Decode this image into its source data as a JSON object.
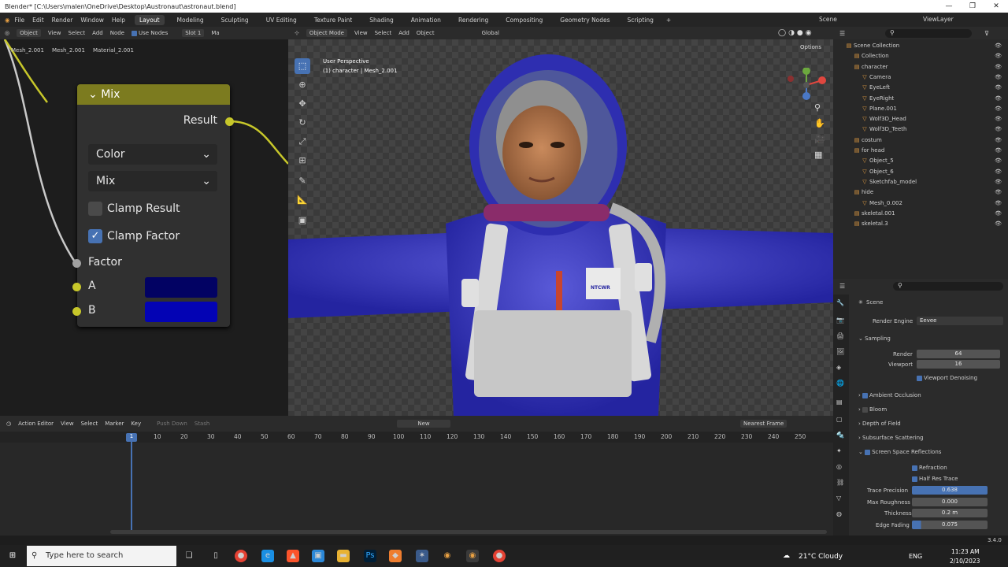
{
  "window": {
    "title": "Blender* [C:\\Users\\malen\\OneDrive\\Desktop\\Austronaut\\astronaut.blend]"
  },
  "menu": {
    "items": [
      "File",
      "Edit",
      "Render",
      "Window",
      "Help"
    ],
    "workspaces": [
      "Layout",
      "Modeling",
      "Sculpting",
      "UV Editing",
      "Texture Paint",
      "Shading",
      "Animation",
      "Rendering",
      "Compositing",
      "Geometry Nodes",
      "Scripting"
    ],
    "add": "+",
    "scene_label": "Scene",
    "viewlayer_label": "ViewLayer"
  },
  "node_editor": {
    "header": {
      "mode": "Object",
      "menus": [
        "View",
        "Select",
        "Add",
        "Node"
      ],
      "use_nodes": "Use Nodes",
      "slot": "Slot 1",
      "truncated": "Ma"
    },
    "breadcrumb": [
      "Mesh_2.001",
      "Mesh_2.001",
      "Material_2.001"
    ],
    "node": {
      "title": "Mix",
      "output": "Result",
      "data_type": "Color",
      "blend_mode": "Mix",
      "clamp_result": "Clamp Result",
      "clamp_factor": "Clamp Factor",
      "factor": "Factor",
      "input_a": "A",
      "input_b": "B",
      "color_a": "#020263",
      "color_b": "#0303b4",
      "clamp_result_checked": false,
      "clamp_factor_checked": true
    }
  },
  "viewport": {
    "header": {
      "mode": "Object Mode",
      "menus": [
        "View",
        "Select",
        "Add",
        "Object"
      ],
      "transform": "Global"
    },
    "overlay_line1": "User Perspective",
    "overlay_line2": "(1) character | Mesh_2.001",
    "options": "Options",
    "badge": "NTCWR"
  },
  "timeline": {
    "editor": "Action Editor",
    "menus": [
      "View",
      "Select",
      "Marker",
      "Key"
    ],
    "push_down": "Push Down",
    "stash": "Stash",
    "new": "New",
    "snap": "Nearest Frame",
    "current_frame": "1",
    "ticks": [
      "10",
      "20",
      "30",
      "40",
      "50",
      "60",
      "70",
      "80",
      "90",
      "100",
      "110",
      "120",
      "130",
      "140",
      "150",
      "160",
      "170",
      "180",
      "190",
      "200",
      "210",
      "220",
      "230",
      "240",
      "250"
    ]
  },
  "outliner": {
    "rows": [
      {
        "name": "Scene Collection",
        "indent": 0
      },
      {
        "name": "Collection",
        "indent": 1
      },
      {
        "name": "character",
        "indent": 1
      },
      {
        "name": "Camera",
        "indent": 2
      },
      {
        "name": "EyeLeft",
        "indent": 2
      },
      {
        "name": "EyeRight",
        "indent": 2
      },
      {
        "name": "Plane.001",
        "indent": 2
      },
      {
        "name": "Wolf3D_Head",
        "indent": 2
      },
      {
        "name": "Wolf3D_Teeth",
        "indent": 2
      },
      {
        "name": "costum",
        "indent": 1
      },
      {
        "name": "for head",
        "indent": 1
      },
      {
        "name": "Object_5",
        "indent": 2
      },
      {
        "name": "Object_6",
        "indent": 2
      },
      {
        "name": "Sketchfab_model",
        "indent": 2
      },
      {
        "name": "hide",
        "indent": 1
      },
      {
        "name": "Mesh_0.002",
        "indent": 2
      },
      {
        "name": "skeletal.001",
        "indent": 1
      },
      {
        "name": "skeletal.3",
        "indent": 1
      }
    ]
  },
  "properties": {
    "scene": "Scene",
    "render_engine_label": "Render Engine",
    "render_engine": "Eevee",
    "sampling": "Sampling",
    "render_label": "Render",
    "render_value": "64",
    "viewport_label": "Viewport",
    "viewport_value": "16",
    "viewport_denoising": "Viewport Denoising",
    "ambient_occlusion": "Ambient Occlusion",
    "bloom": "Bloom",
    "depth_of_field": "Depth of Field",
    "subsurface": "Subsurface Scattering",
    "ssr": "Screen Space Reflections",
    "refraction": "Refraction",
    "half_res": "Half Res Trace",
    "trace_precision_label": "Trace Precision",
    "trace_precision": "0.638",
    "max_roughness_label": "Max Roughness",
    "max_roughness": "0.000",
    "thickness_label": "Thickness",
    "thickness": "0.2 m",
    "edge_fading_label": "Edge Fading",
    "edge_fading": "0.075"
  },
  "status": {
    "version": "3.4.0"
  },
  "taskbar": {
    "search": "Type here to search",
    "weather": "21°C  Cloudy",
    "lang": "ENG",
    "time": "11:23 AM",
    "date": "2/10/2023"
  }
}
